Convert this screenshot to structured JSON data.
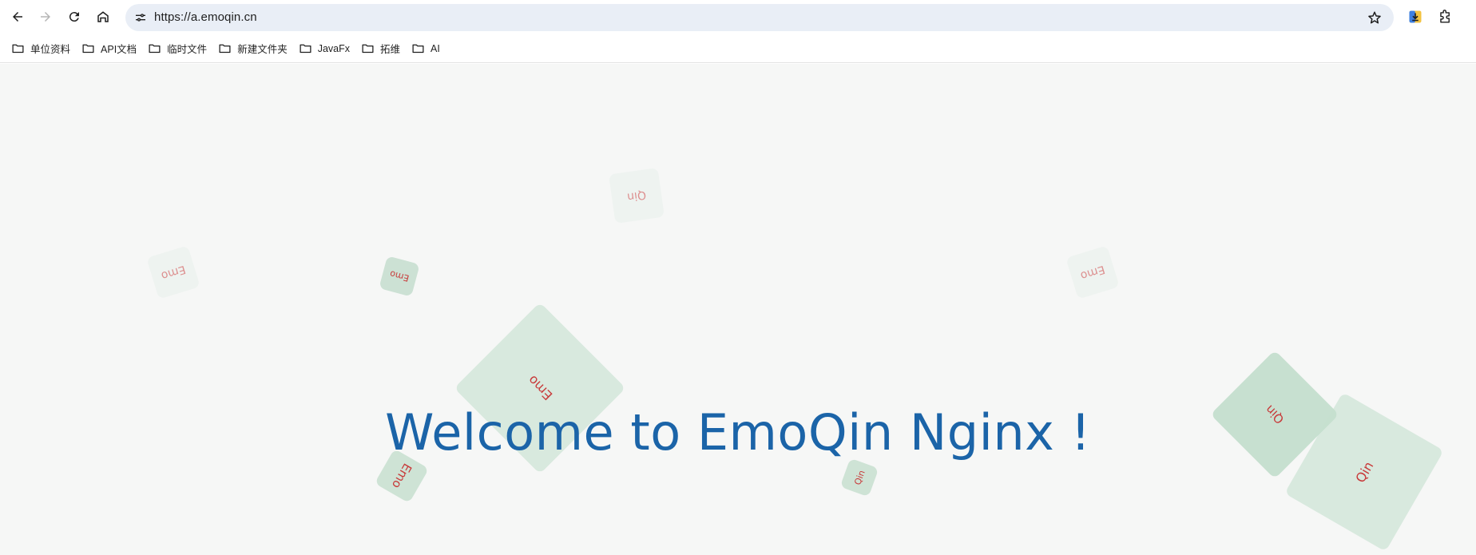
{
  "browser": {
    "url": "https://a.emoqin.cn",
    "icons": {
      "back": "back-arrow-icon",
      "forward": "forward-arrow-icon",
      "reload": "reload-icon",
      "home": "home-icon",
      "site_info": "site-info-icon",
      "bookmark_star": "star-icon",
      "download_ext": "download-extension-icon",
      "extensions": "puzzle-icon"
    }
  },
  "bookmarks": [
    {
      "label": "单位资料"
    },
    {
      "label": "API文档"
    },
    {
      "label": "临时文件"
    },
    {
      "label": "新建文件夹"
    },
    {
      "label": "JavaFx"
    },
    {
      "label": "拓维"
    },
    {
      "label": "AI"
    }
  ],
  "page": {
    "heading": "Welcome to EmoQin Nginx !",
    "cubes": [
      {
        "label": "Qin"
      },
      {
        "label": "Emo"
      },
      {
        "label": "Emo"
      },
      {
        "label": "Emo"
      },
      {
        "label": "Emo"
      },
      {
        "label": "Emo"
      },
      {
        "label": "Qin"
      },
      {
        "label": "Qin"
      },
      {
        "label": "Qin"
      }
    ],
    "colors": {
      "heading": "#1b64a8",
      "cube_label": "#c83a3a",
      "cube_fill": "#cfe3d6"
    }
  }
}
